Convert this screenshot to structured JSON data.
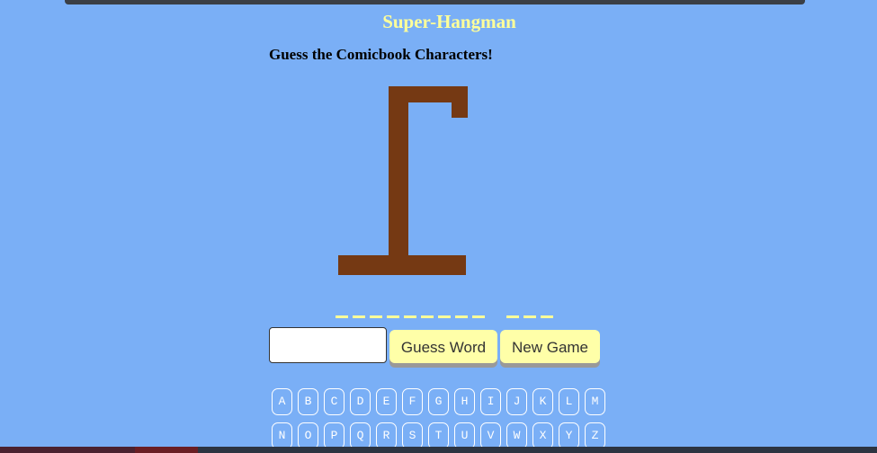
{
  "title": "Super-Hangman",
  "subtitle": "Guess the Comicbook Characters!",
  "word_blanks": {
    "pattern": "_________ ___"
  },
  "guess_input": {
    "value": "",
    "placeholder": ""
  },
  "buttons": {
    "guess_word": "Guess Word",
    "new_game": "New Game"
  },
  "letters_row1": [
    "A",
    "B",
    "C",
    "D",
    "E",
    "F",
    "G",
    "H",
    "I",
    "J",
    "K",
    "L",
    "M"
  ],
  "letters_row2": [
    "N",
    "O",
    "P",
    "Q",
    "R",
    "S",
    "T",
    "U",
    "V",
    "W",
    "X",
    "Y",
    "Z"
  ],
  "colors": {
    "background": "#7aaff6",
    "title": "#ffff99",
    "gallows": "#753913",
    "button": "#ffffa8"
  }
}
